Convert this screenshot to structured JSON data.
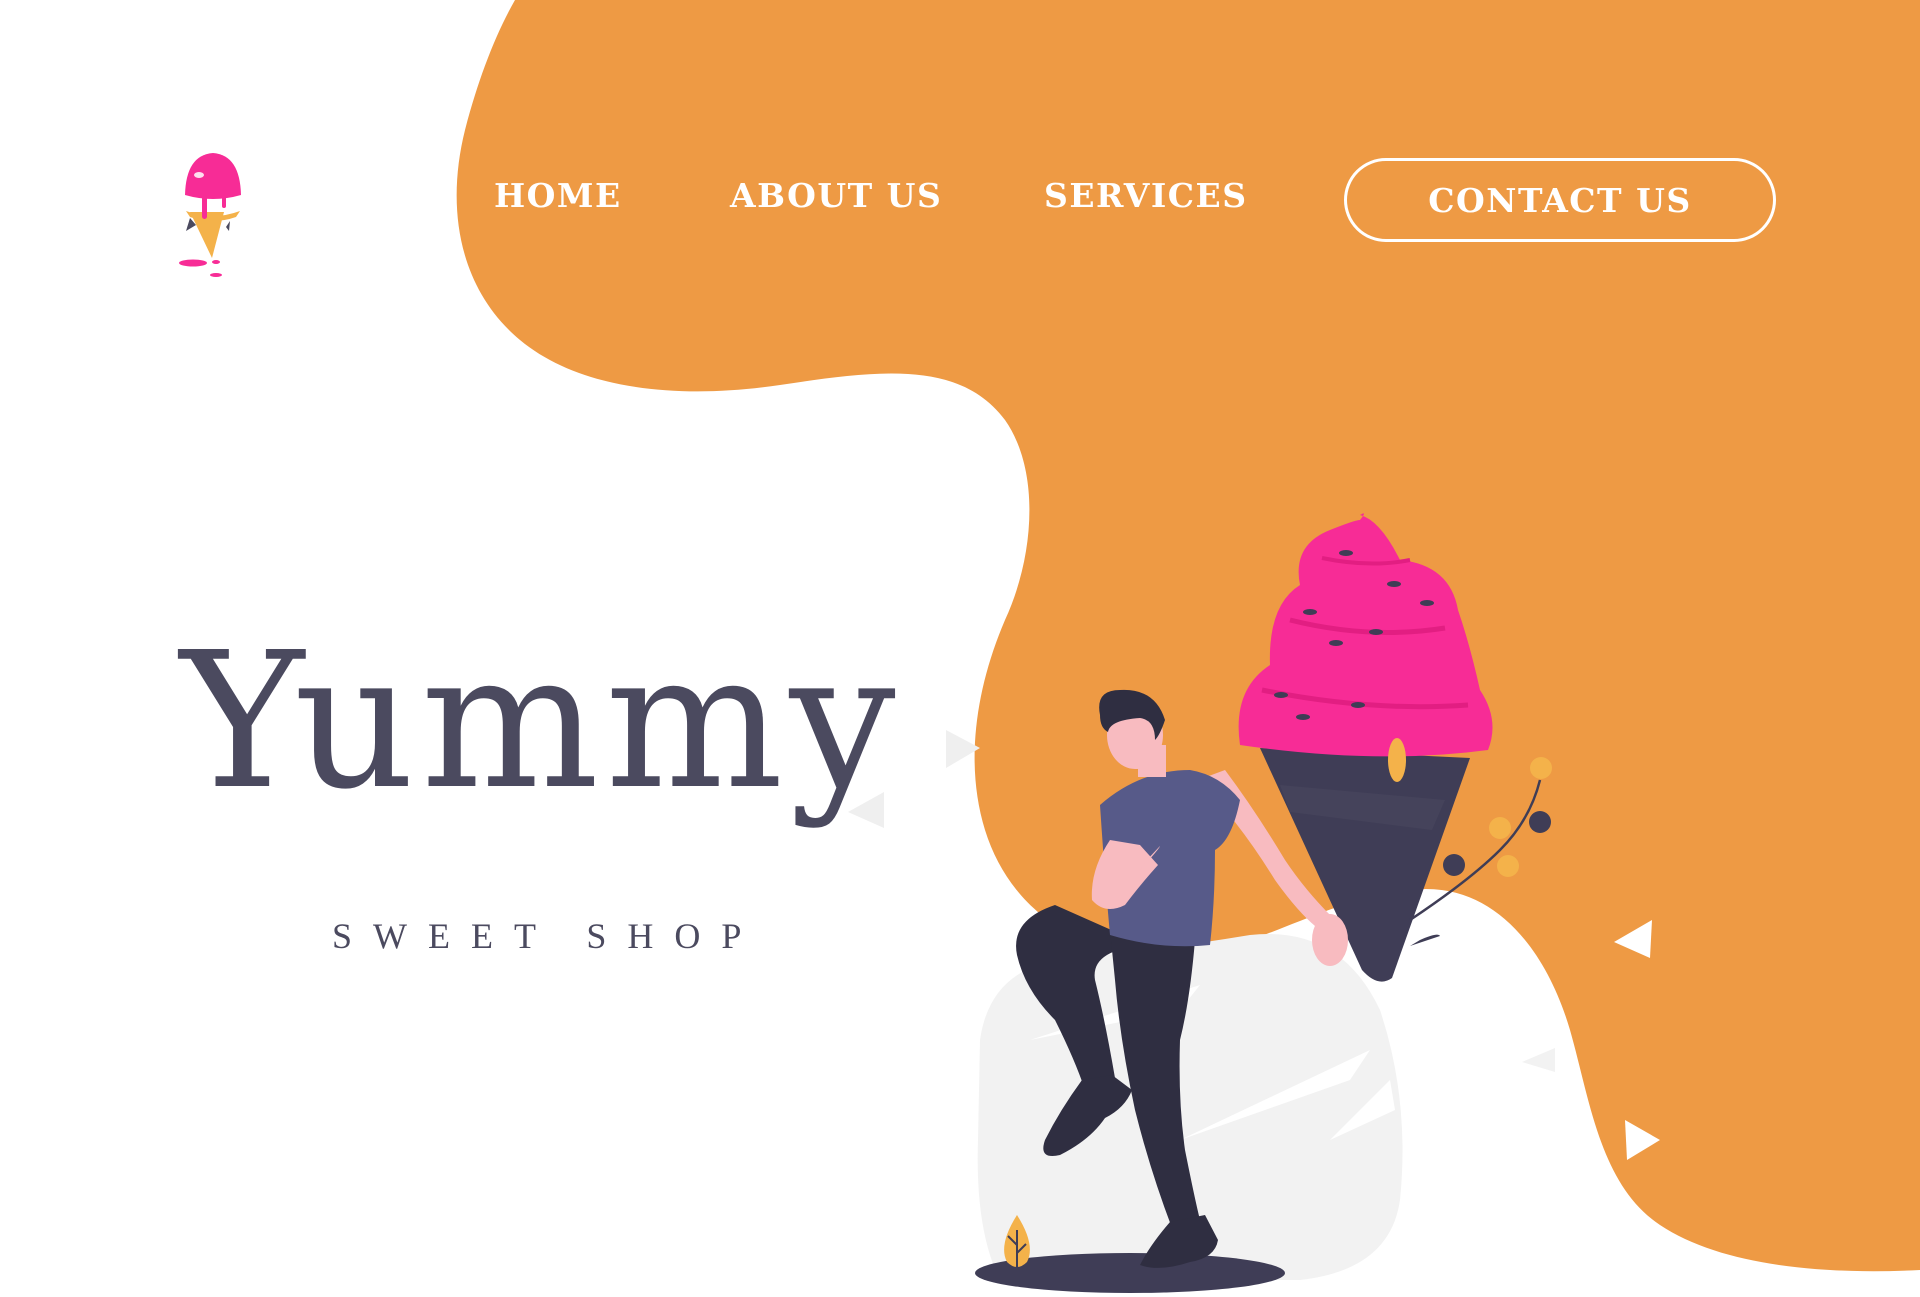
{
  "brand": {
    "logo_icon": "ice-cream-cone-icon"
  },
  "nav": {
    "home": "HOME",
    "about": "ABOUT US",
    "services": "SERVICES",
    "contact": "CONTACT US"
  },
  "hero": {
    "title": "Yummy",
    "subtitle": "SWEET SHOP"
  },
  "colors": {
    "orange": "#EE9A44",
    "pink": "#F72C96",
    "dark": "#4B4A5F",
    "cone": "#3F3D56",
    "white": "#FFFFFF"
  }
}
